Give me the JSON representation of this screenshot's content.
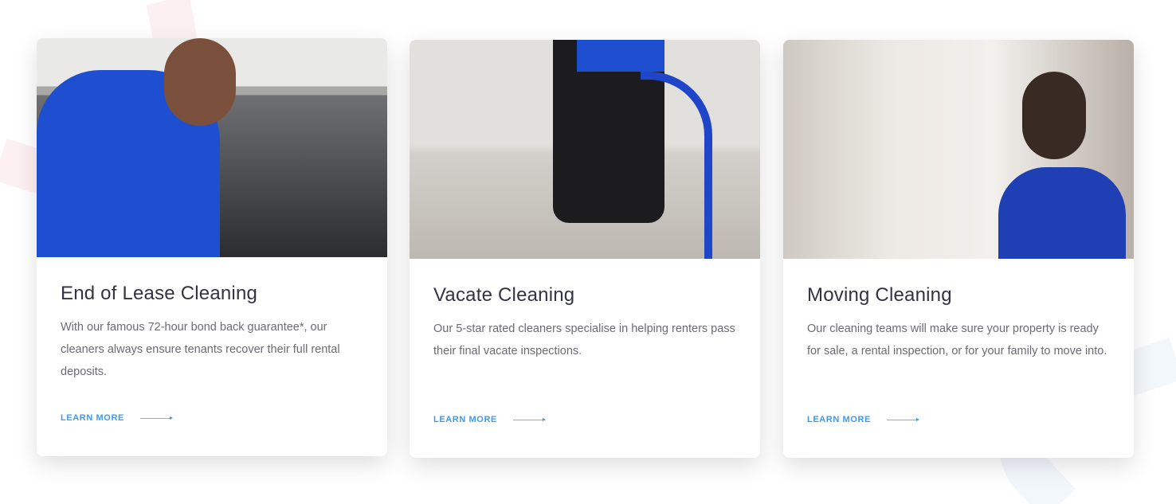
{
  "accent_color": "#3d9bef",
  "cards": [
    {
      "title": "End of Lease Cleaning",
      "description": "With our famous 72-hour bond back guarantee*, our cleaners always ensure tenants recover their full rental deposits.",
      "link_label": "LEARN MORE",
      "icon": "arrow-right-icon"
    },
    {
      "title": "Vacate Cleaning",
      "description": "Our 5-star rated cleaners specialise in helping renters pass their final vacate inspections.",
      "link_label": "LEARN MORE",
      "icon": "arrow-right-icon"
    },
    {
      "title": "Moving Cleaning",
      "description": "Our cleaning teams will make sure your property is ready for sale, a rental inspection, or for your family to move into.",
      "link_label": "LEARN MORE",
      "icon": "arrow-right-icon"
    }
  ]
}
